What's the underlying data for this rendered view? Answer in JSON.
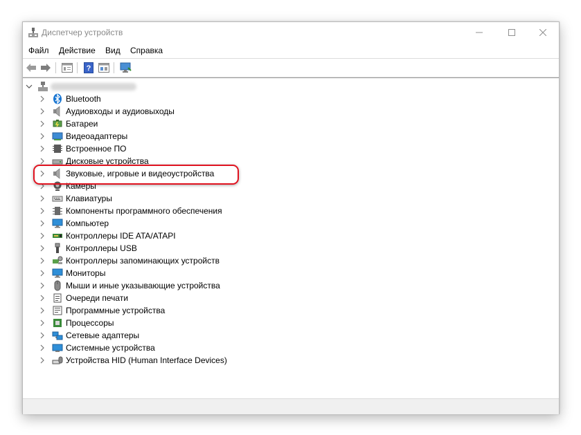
{
  "window": {
    "title": "Диспетчер устройств"
  },
  "menu": [
    "Файл",
    "Действие",
    "Вид",
    "Справка"
  ],
  "toolbar": [
    "back-arrow-icon",
    "forward-arrow-icon",
    "properties-icon",
    "help-icon",
    "view-icon",
    "monitor-scan-icon"
  ],
  "tree": {
    "root": {
      "label": "",
      "icon": "computer-icon",
      "expanded": true
    },
    "categories": [
      {
        "label": "Bluetooth",
        "icon": "bluetooth-icon"
      },
      {
        "label": "Аудиовходы и аудиовыходы",
        "icon": "speaker-icon"
      },
      {
        "label": "Батареи",
        "icon": "battery-icon"
      },
      {
        "label": "Видеоадаптеры",
        "icon": "display-adapter-icon"
      },
      {
        "label": "Встроенное ПО",
        "icon": "firmware-icon"
      },
      {
        "label": "Дисковые устройства",
        "icon": "disk-icon"
      },
      {
        "label": "Звуковые, игровые и видеоустройства",
        "icon": "speaker-icon",
        "highlighted": true
      },
      {
        "label": "Камеры",
        "icon": "camera-icon"
      },
      {
        "label": "Клавиатуры",
        "icon": "keyboard-icon"
      },
      {
        "label": "Компоненты программного обеспечения",
        "icon": "software-component-icon"
      },
      {
        "label": "Компьютер",
        "icon": "monitor-icon"
      },
      {
        "label": "Контроллеры IDE ATA/ATAPI",
        "icon": "ide-controller-icon"
      },
      {
        "label": "Контроллеры USB",
        "icon": "usb-icon"
      },
      {
        "label": "Контроллеры запоминающих устройств",
        "icon": "storage-controller-icon"
      },
      {
        "label": "Мониторы",
        "icon": "monitor-icon"
      },
      {
        "label": "Мыши и иные указывающие устройства",
        "icon": "mouse-icon"
      },
      {
        "label": "Очереди печати",
        "icon": "printer-icon"
      },
      {
        "label": "Программные устройства",
        "icon": "software-device-icon"
      },
      {
        "label": "Процессоры",
        "icon": "processor-icon"
      },
      {
        "label": "Сетевые адаптеры",
        "icon": "network-adapter-icon"
      },
      {
        "label": "Системные устройства",
        "icon": "system-device-icon"
      },
      {
        "label": "Устройства HID (Human Interface Devices)",
        "icon": "hid-icon"
      }
    ]
  },
  "colors": {
    "highlight": "#e0121f",
    "bluetooth": "#1976d2",
    "monitor": "#2f8fd8"
  }
}
